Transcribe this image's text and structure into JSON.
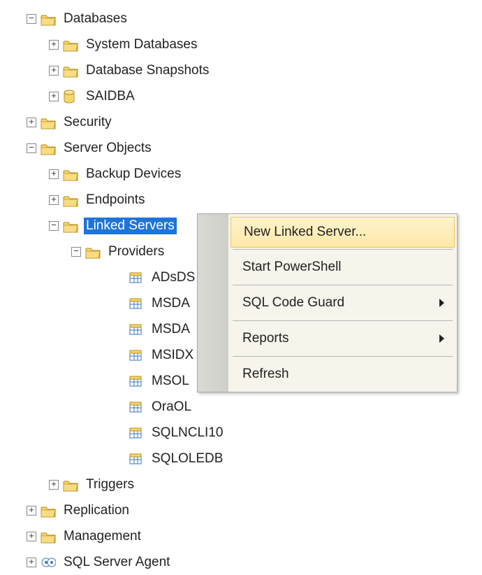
{
  "tree": {
    "databases": {
      "label": "Databases",
      "children": {
        "system_databases": "System Databases",
        "database_snapshots": "Database Snapshots",
        "saidba": "SAIDBA"
      }
    },
    "security": "Security",
    "server_objects": {
      "label": "Server Objects",
      "children": {
        "backup_devices": "Backup Devices",
        "endpoints": "Endpoints",
        "linked_servers": {
          "label": "Linked Servers",
          "children": {
            "providers": {
              "label": "Providers",
              "items": [
                "ADsDS",
                "MSDA",
                "MSDA",
                "MSIDX",
                "MSOL",
                "OraOL",
                "SQLNCLI10",
                "SQLOLEDB"
              ]
            }
          }
        },
        "triggers": "Triggers"
      }
    },
    "replication": "Replication",
    "management": "Management",
    "sql_server_agent": "SQL Server Agent"
  },
  "context_menu": {
    "new_linked_server": "New Linked Server...",
    "start_powershell": "Start PowerShell",
    "sql_code_guard": "SQL Code Guard",
    "reports": "Reports",
    "refresh": "Refresh"
  }
}
